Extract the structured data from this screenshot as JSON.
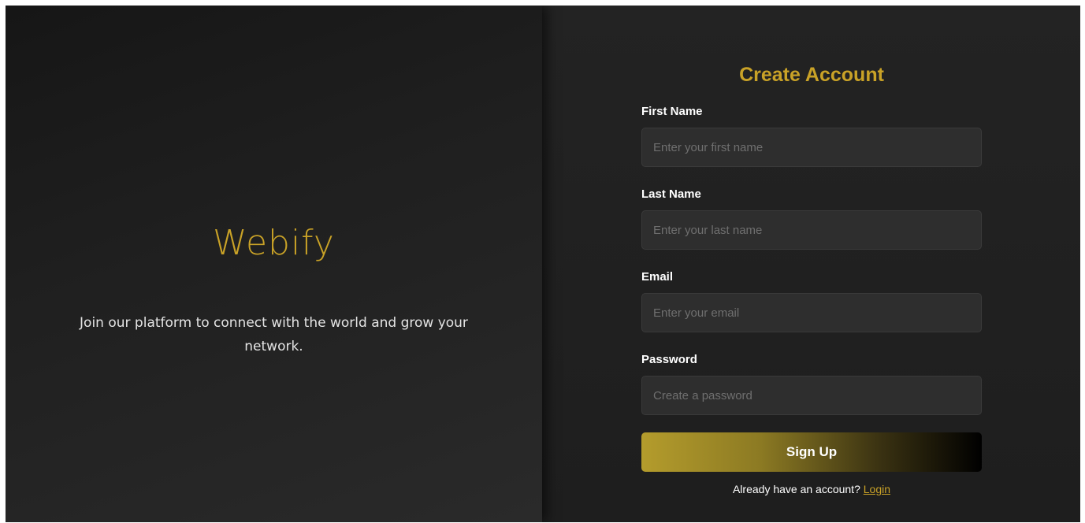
{
  "brand": {
    "name": "Webify",
    "tagline": "Join our platform to connect with the world and grow your network."
  },
  "form": {
    "title": "Create Account",
    "fields": [
      {
        "label": "First Name",
        "placeholder": "Enter your first name",
        "value": ""
      },
      {
        "label": "Last Name",
        "placeholder": "Enter your last name",
        "value": ""
      },
      {
        "label": "Email",
        "placeholder": "Enter your email",
        "value": ""
      },
      {
        "label": "Password",
        "placeholder": "Create a password",
        "value": ""
      }
    ],
    "submit_label": "Sign Up",
    "login_prompt": "Already have an account?",
    "login_link": "Login"
  },
  "colors": {
    "accent": "#c9a227",
    "background_left": "#1f1f1f",
    "background_right": "#222222",
    "input_bg": "#2e2e2e"
  }
}
